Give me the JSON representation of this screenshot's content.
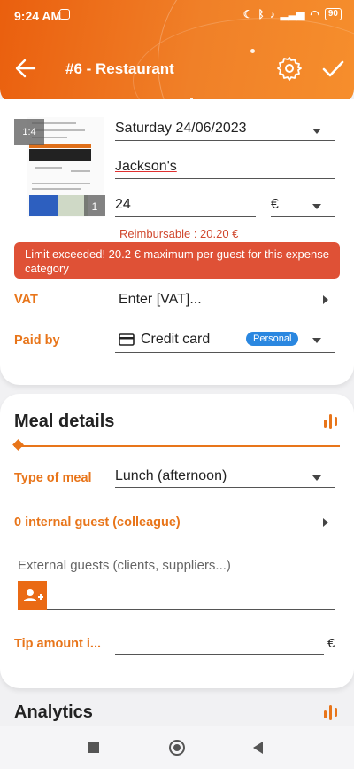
{
  "status_bar": {
    "time": "9:24 AM",
    "battery": "90"
  },
  "header": {
    "title": "#6 - Restaurant"
  },
  "receipt": {
    "page_badge": "1:4",
    "count_badge": "1"
  },
  "expense": {
    "date": "Saturday 24/06/2023",
    "merchant": "Jackson's",
    "amount": "24",
    "currency": "€",
    "reimbursable": "Reimbursable : 20.20 €",
    "alert": "Limit exceeded! 20.2 € maximum per guest for this expense category",
    "vat_label": "VAT",
    "vat_placeholder": "Enter [VAT]...",
    "paid_by_label": "Paid by",
    "paid_by_value": "Credit card",
    "paid_by_tag": "Personal"
  },
  "meal": {
    "section_title": "Meal details",
    "type_label": "Type of meal",
    "type_value": "Lunch (afternoon)",
    "internal_guests": "0 internal guest (colleague)",
    "external_guests_label": "External guests (clients, suppliers...)",
    "tip_label": "Tip amount i...",
    "tip_currency": "€"
  },
  "analytics": {
    "section_title": "Analytics"
  },
  "colors": {
    "accent": "#e8751a",
    "alert": "#df5136",
    "pill": "#2a87e0"
  }
}
